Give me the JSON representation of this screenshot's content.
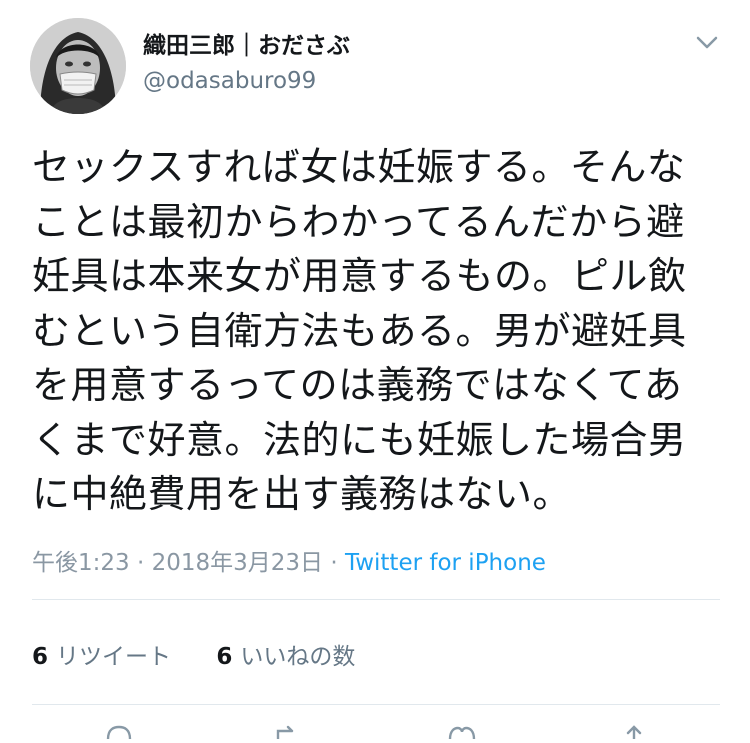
{
  "user": {
    "display_name": "織田三郎｜おださぶ",
    "handle": "@odasaburo99",
    "avatar_icon": "user-avatar"
  },
  "menu_icon": "chevron-down-icon",
  "tweet": {
    "lines": [
      "セックスすれば女は妊娠する。そんな",
      "ことは最初からわかってるんだから避",
      "妊具は本来女が用意するもの。ピル飲",
      "むという自衛方法もある。男が避妊具",
      "を用意するってのは義務ではなくてあ",
      "くまで好意。法的にも妊娠した場合男",
      "に中絶費用を出す義務はない。"
    ]
  },
  "meta": {
    "time": "午後1:23",
    "separator1": " · ",
    "date": "2018年3月23日",
    "separator2": " · ",
    "source": "Twitter for iPhone"
  },
  "stats": {
    "retweets_count": "6",
    "retweets_label": "リツイート",
    "likes_count": "6",
    "likes_label": "いいねの数"
  },
  "actions": [
    "reply-icon",
    "retweet-icon",
    "like-icon",
    "share-icon"
  ],
  "colors": {
    "text": "#14171a",
    "secondary": "#657786",
    "link": "#1da1f2",
    "divider": "#e1e8ed"
  }
}
